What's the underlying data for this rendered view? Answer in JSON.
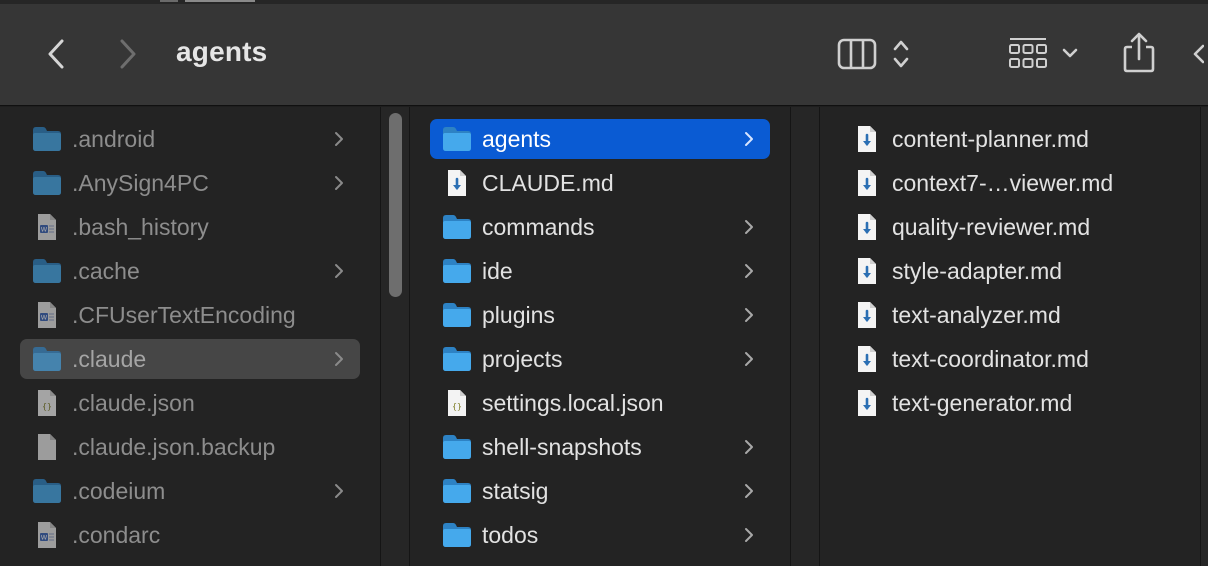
{
  "window": {
    "title": "agents"
  },
  "toolbar": {
    "back_icon": "chevron-left-icon",
    "forward_icon": "chevron-right-icon",
    "view_icon": "column-view-icon",
    "group_icon": "group-grid-icon",
    "share_icon": "share-icon"
  },
  "colors": {
    "selection_blue": "#0a5bd3",
    "folder_blue": "#3fa2e6",
    "background": "#232323"
  },
  "column1": {
    "items": [
      {
        "name": ".android",
        "type": "folder",
        "chevron": true
      },
      {
        "name": ".AnySign4PC",
        "type": "folder",
        "chevron": true
      },
      {
        "name": ".bash_history",
        "type": "document",
        "chevron": false
      },
      {
        "name": ".cache",
        "type": "folder",
        "chevron": true
      },
      {
        "name": ".CFUserTextEncoding",
        "type": "document",
        "chevron": false
      },
      {
        "name": ".claude",
        "type": "folder",
        "chevron": true,
        "selected": true
      },
      {
        "name": ".claude.json",
        "type": "json",
        "chevron": false
      },
      {
        "name": ".claude.json.backup",
        "type": "blank",
        "chevron": false
      },
      {
        "name": ".codeium",
        "type": "folder",
        "chevron": true
      },
      {
        "name": ".condarc",
        "type": "document",
        "chevron": false
      }
    ]
  },
  "column2": {
    "items": [
      {
        "name": "agents",
        "type": "folder",
        "chevron": true,
        "selected": true
      },
      {
        "name": "CLAUDE.md",
        "type": "markdown",
        "chevron": false
      },
      {
        "name": "commands",
        "type": "folder",
        "chevron": true
      },
      {
        "name": "ide",
        "type": "folder",
        "chevron": true
      },
      {
        "name": "plugins",
        "type": "folder",
        "chevron": true
      },
      {
        "name": "projects",
        "type": "folder",
        "chevron": true
      },
      {
        "name": "settings.local.json",
        "type": "json",
        "chevron": false
      },
      {
        "name": "shell-snapshots",
        "type": "folder",
        "chevron": true
      },
      {
        "name": "statsig",
        "type": "folder",
        "chevron": true
      },
      {
        "name": "todos",
        "type": "folder",
        "chevron": true
      }
    ]
  },
  "column3": {
    "items": [
      {
        "name": "content-planner.md",
        "type": "markdown"
      },
      {
        "name": "context7-…viewer.md",
        "type": "markdown"
      },
      {
        "name": "quality-reviewer.md",
        "type": "markdown"
      },
      {
        "name": "style-adapter.md",
        "type": "markdown"
      },
      {
        "name": "text-analyzer.md",
        "type": "markdown"
      },
      {
        "name": "text-coordinator.md",
        "type": "markdown"
      },
      {
        "name": "text-generator.md",
        "type": "markdown"
      }
    ]
  }
}
